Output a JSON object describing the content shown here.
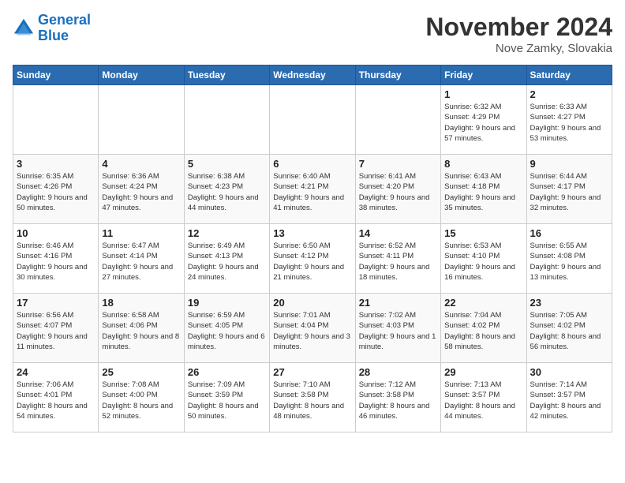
{
  "header": {
    "logo_line1": "General",
    "logo_line2": "Blue",
    "title": "November 2024",
    "subtitle": "Nove Zamky, Slovakia"
  },
  "days_of_week": [
    "Sunday",
    "Monday",
    "Tuesday",
    "Wednesday",
    "Thursday",
    "Friday",
    "Saturday"
  ],
  "weeks": [
    [
      {
        "day": "",
        "info": ""
      },
      {
        "day": "",
        "info": ""
      },
      {
        "day": "",
        "info": ""
      },
      {
        "day": "",
        "info": ""
      },
      {
        "day": "",
        "info": ""
      },
      {
        "day": "1",
        "info": "Sunrise: 6:32 AM\nSunset: 4:29 PM\nDaylight: 9 hours\nand 57 minutes."
      },
      {
        "day": "2",
        "info": "Sunrise: 6:33 AM\nSunset: 4:27 PM\nDaylight: 9 hours\nand 53 minutes."
      }
    ],
    [
      {
        "day": "3",
        "info": "Sunrise: 6:35 AM\nSunset: 4:26 PM\nDaylight: 9 hours\nand 50 minutes."
      },
      {
        "day": "4",
        "info": "Sunrise: 6:36 AM\nSunset: 4:24 PM\nDaylight: 9 hours\nand 47 minutes."
      },
      {
        "day": "5",
        "info": "Sunrise: 6:38 AM\nSunset: 4:23 PM\nDaylight: 9 hours\nand 44 minutes."
      },
      {
        "day": "6",
        "info": "Sunrise: 6:40 AM\nSunset: 4:21 PM\nDaylight: 9 hours\nand 41 minutes."
      },
      {
        "day": "7",
        "info": "Sunrise: 6:41 AM\nSunset: 4:20 PM\nDaylight: 9 hours\nand 38 minutes."
      },
      {
        "day": "8",
        "info": "Sunrise: 6:43 AM\nSunset: 4:18 PM\nDaylight: 9 hours\nand 35 minutes."
      },
      {
        "day": "9",
        "info": "Sunrise: 6:44 AM\nSunset: 4:17 PM\nDaylight: 9 hours\nand 32 minutes."
      }
    ],
    [
      {
        "day": "10",
        "info": "Sunrise: 6:46 AM\nSunset: 4:16 PM\nDaylight: 9 hours\nand 30 minutes."
      },
      {
        "day": "11",
        "info": "Sunrise: 6:47 AM\nSunset: 4:14 PM\nDaylight: 9 hours\nand 27 minutes."
      },
      {
        "day": "12",
        "info": "Sunrise: 6:49 AM\nSunset: 4:13 PM\nDaylight: 9 hours\nand 24 minutes."
      },
      {
        "day": "13",
        "info": "Sunrise: 6:50 AM\nSunset: 4:12 PM\nDaylight: 9 hours\nand 21 minutes."
      },
      {
        "day": "14",
        "info": "Sunrise: 6:52 AM\nSunset: 4:11 PM\nDaylight: 9 hours\nand 18 minutes."
      },
      {
        "day": "15",
        "info": "Sunrise: 6:53 AM\nSunset: 4:10 PM\nDaylight: 9 hours\nand 16 minutes."
      },
      {
        "day": "16",
        "info": "Sunrise: 6:55 AM\nSunset: 4:08 PM\nDaylight: 9 hours\nand 13 minutes."
      }
    ],
    [
      {
        "day": "17",
        "info": "Sunrise: 6:56 AM\nSunset: 4:07 PM\nDaylight: 9 hours\nand 11 minutes."
      },
      {
        "day": "18",
        "info": "Sunrise: 6:58 AM\nSunset: 4:06 PM\nDaylight: 9 hours\nand 8 minutes."
      },
      {
        "day": "19",
        "info": "Sunrise: 6:59 AM\nSunset: 4:05 PM\nDaylight: 9 hours\nand 6 minutes."
      },
      {
        "day": "20",
        "info": "Sunrise: 7:01 AM\nSunset: 4:04 PM\nDaylight: 9 hours\nand 3 minutes."
      },
      {
        "day": "21",
        "info": "Sunrise: 7:02 AM\nSunset: 4:03 PM\nDaylight: 9 hours\nand 1 minute."
      },
      {
        "day": "22",
        "info": "Sunrise: 7:04 AM\nSunset: 4:02 PM\nDaylight: 8 hours\nand 58 minutes."
      },
      {
        "day": "23",
        "info": "Sunrise: 7:05 AM\nSunset: 4:02 PM\nDaylight: 8 hours\nand 56 minutes."
      }
    ],
    [
      {
        "day": "24",
        "info": "Sunrise: 7:06 AM\nSunset: 4:01 PM\nDaylight: 8 hours\nand 54 minutes."
      },
      {
        "day": "25",
        "info": "Sunrise: 7:08 AM\nSunset: 4:00 PM\nDaylight: 8 hours\nand 52 minutes."
      },
      {
        "day": "26",
        "info": "Sunrise: 7:09 AM\nSunset: 3:59 PM\nDaylight: 8 hours\nand 50 minutes."
      },
      {
        "day": "27",
        "info": "Sunrise: 7:10 AM\nSunset: 3:58 PM\nDaylight: 8 hours\nand 48 minutes."
      },
      {
        "day": "28",
        "info": "Sunrise: 7:12 AM\nSunset: 3:58 PM\nDaylight: 8 hours\nand 46 minutes."
      },
      {
        "day": "29",
        "info": "Sunrise: 7:13 AM\nSunset: 3:57 PM\nDaylight: 8 hours\nand 44 minutes."
      },
      {
        "day": "30",
        "info": "Sunrise: 7:14 AM\nSunset: 3:57 PM\nDaylight: 8 hours\nand 42 minutes."
      }
    ]
  ]
}
